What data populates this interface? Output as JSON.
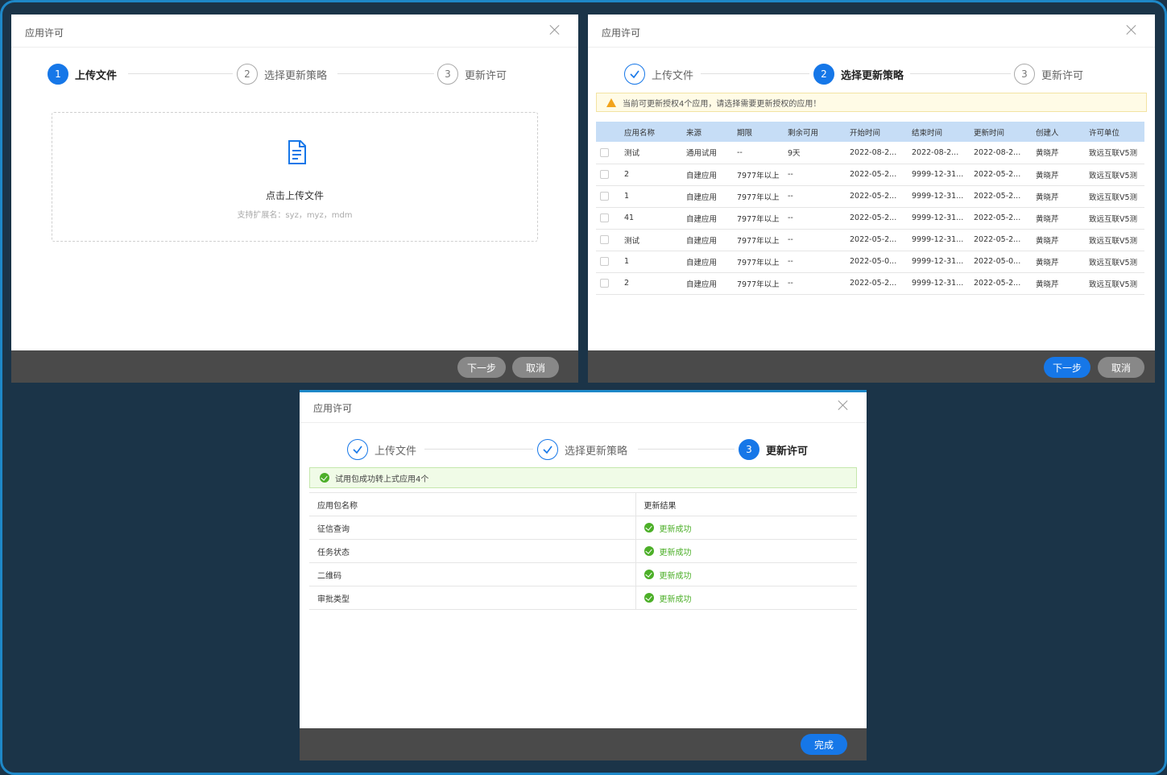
{
  "colors": {
    "primary": "#1677e8",
    "success": "#4caf28",
    "warning": "#f2a31b",
    "error": "#e03b2f",
    "footer": "#4a4a4a",
    "background": "#1b3448"
  },
  "dialog1": {
    "title": "应用许可",
    "steps": [
      {
        "num": "1",
        "label": "上传文件",
        "state": "active"
      },
      {
        "num": "2",
        "label": "选择更新策略",
        "state": "pending"
      },
      {
        "num": "3",
        "label": "更新许可",
        "state": "pending"
      }
    ],
    "upload": {
      "icon": "document-icon",
      "title": "点击上传文件",
      "hint": "支持扩展名：syz，myz，mdm"
    },
    "buttons": {
      "next": "下一步",
      "cancel": "取消"
    }
  },
  "dialog2": {
    "title": "应用许可",
    "steps": [
      {
        "num": "",
        "label": "上传文件",
        "state": "done"
      },
      {
        "num": "2",
        "label": "选择更新策略",
        "state": "active"
      },
      {
        "num": "3",
        "label": "更新许可",
        "state": "pending"
      }
    ],
    "warning": "当前可更新授权4个应用，请选择需要更新授权的应用！",
    "columns": [
      "应用名称",
      "来源",
      "期限",
      "剩余可用",
      "开始时间",
      "结束时间",
      "更新时间",
      "创建人",
      "许可单位"
    ],
    "rows": [
      [
        "测试",
        "通用试用",
        "--",
        "9天",
        "2022-08-2...",
        "2022-08-2...",
        "2022-08-2...",
        "黄晓芹",
        "致远互联V5测"
      ],
      [
        "2",
        "自建应用",
        "7977年以上",
        "--",
        "2022-05-2...",
        "9999-12-31...",
        "2022-05-2...",
        "黄晓芹",
        "致远互联V5测"
      ],
      [
        "1",
        "自建应用",
        "7977年以上",
        "--",
        "2022-05-2...",
        "9999-12-31...",
        "2022-05-2...",
        "黄晓芹",
        "致远互联V5测"
      ],
      [
        "41",
        "自建应用",
        "7977年以上",
        "--",
        "2022-05-2...",
        "9999-12-31...",
        "2022-05-2...",
        "黄晓芹",
        "致远互联V5测"
      ],
      [
        "测试",
        "自建应用",
        "7977年以上",
        "--",
        "2022-05-2...",
        "9999-12-31...",
        "2022-05-2...",
        "黄晓芹",
        "致远互联V5测"
      ],
      [
        "1",
        "自建应用",
        "7977年以上",
        "--",
        "2022-05-0...",
        "9999-12-31...",
        "2022-05-0...",
        "黄晓芹",
        "致远互联V5测"
      ],
      [
        "2",
        "自建应用",
        "7977年以上",
        "--",
        "2022-05-2...",
        "9999-12-31...",
        "2022-05-2...",
        "黄晓芹",
        "致远互联V5测"
      ]
    ],
    "buttons": {
      "next": "下一步",
      "cancel": "取消"
    }
  },
  "dialog3": {
    "title": "应用许可",
    "steps": [
      {
        "num": "",
        "label": "上传文件",
        "state": "done"
      },
      {
        "num": "",
        "label": "选择更新策略",
        "state": "done"
      },
      {
        "num": "3",
        "label": "更新许可",
        "state": "active"
      }
    ],
    "success": "试用包成功转上式应用4个",
    "columns": [
      "应用包名称",
      "更新结果"
    ],
    "rows": [
      [
        "征信查询",
        "更新成功"
      ],
      [
        "任务状态",
        "更新成功"
      ],
      [
        "二维码",
        "更新成功"
      ],
      [
        "审批类型",
        "更新成功"
      ]
    ],
    "buttons": {
      "finish": "完成"
    }
  }
}
